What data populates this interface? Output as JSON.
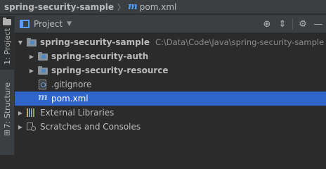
{
  "breadcrumb": {
    "root": "spring-security-sample",
    "separator": "〉",
    "file_icon": "maven-m-icon",
    "file": "pom.xml"
  },
  "left_stripe": {
    "project_tab": "1: Project",
    "structure_tab": "7: Structure"
  },
  "project_panel": {
    "view_icon": "project-view-icon",
    "title": "Project",
    "dropdown_icon": "caret-down-icon",
    "tools": {
      "locate": "⊕",
      "collapse": "⇕",
      "settings": "⚙",
      "hide": "—"
    }
  },
  "tree": {
    "root": {
      "label": "spring-security-sample",
      "path": "C:\\Data\\Code\\Java\\spring-security-sample",
      "expanded": true
    },
    "children": [
      {
        "label": "spring-security-auth",
        "type": "module",
        "expanded": false
      },
      {
        "label": "spring-security-resource",
        "type": "module",
        "expanded": false
      },
      {
        "label": ".gitignore",
        "type": "file"
      },
      {
        "label": "pom.xml",
        "type": "maven",
        "selected": true
      }
    ],
    "external_libraries": "External Libraries",
    "scratches": "Scratches and Consoles"
  },
  "colors": {
    "accent": "#589df6",
    "selection": "#2f65ca",
    "panel": "#3c3f41",
    "background": "#2b2b2b"
  }
}
